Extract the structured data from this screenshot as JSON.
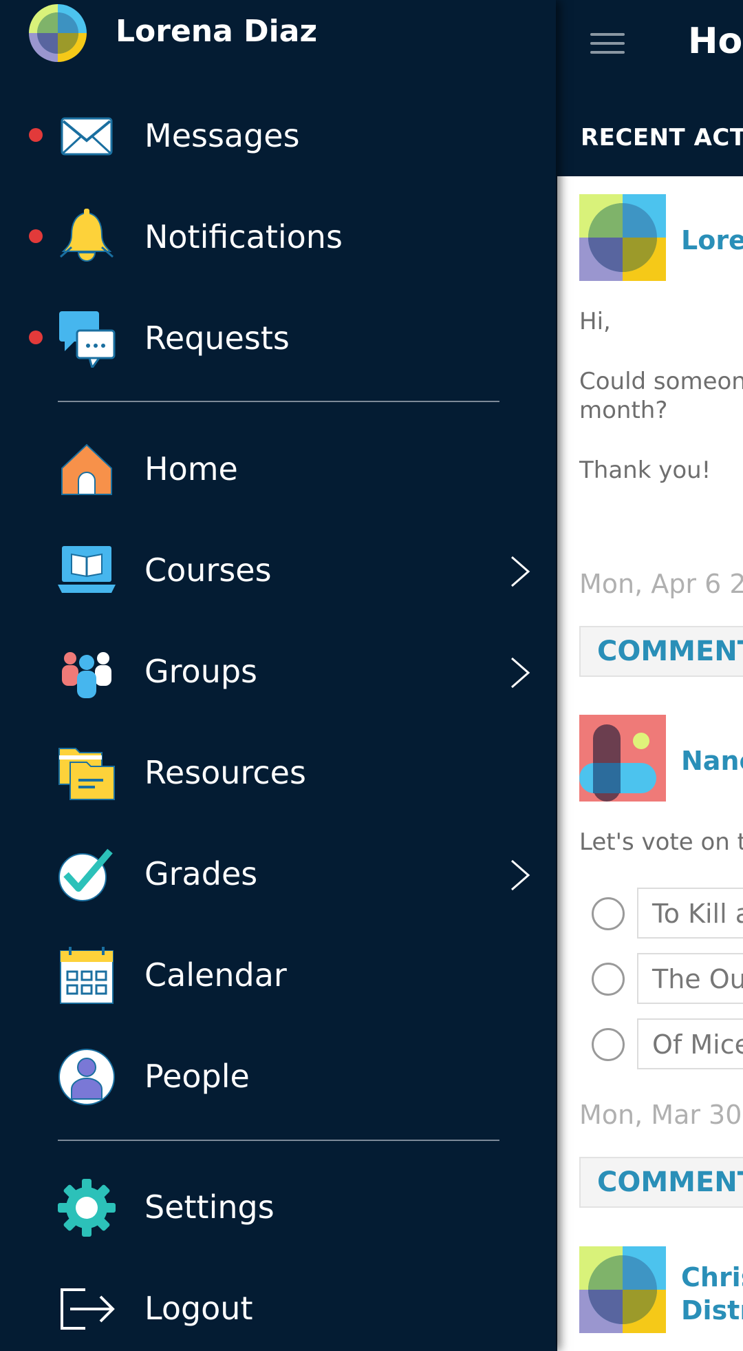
{
  "colors": {
    "navy": "#041c33",
    "accent_blue": "#2a8fb8",
    "alert_red": "#e23a3a"
  },
  "drawer": {
    "profile": {
      "name": "Lorena Diaz",
      "avatar_icon": "quad-avatar-icon"
    },
    "alerts": [
      {
        "label": "Messages",
        "icon": "envelope-icon",
        "has_alert": true
      },
      {
        "label": "Notifications",
        "icon": "bell-icon",
        "has_alert": true
      },
      {
        "label": "Requests",
        "icon": "chat-bubbles-icon",
        "has_alert": true
      }
    ],
    "nav": [
      {
        "label": "Home",
        "icon": "house-icon",
        "has_submenu": false
      },
      {
        "label": "Courses",
        "icon": "laptop-book-icon",
        "has_submenu": true
      },
      {
        "label": "Groups",
        "icon": "people-group-icon",
        "has_submenu": true
      },
      {
        "label": "Resources",
        "icon": "folders-icon",
        "has_submenu": false
      },
      {
        "label": "Grades",
        "icon": "checkmark-icon",
        "has_submenu": true
      },
      {
        "label": "Calendar",
        "icon": "calendar-icon",
        "has_submenu": false
      },
      {
        "label": "People",
        "icon": "person-icon",
        "has_submenu": false
      }
    ],
    "footer": [
      {
        "label": "Settings",
        "icon": "gear-icon"
      },
      {
        "label": "Logout",
        "icon": "logout-icon"
      }
    ]
  },
  "main": {
    "title": "Hor",
    "recent_activity": "RECENT ACTIV",
    "posts": [
      {
        "author": "Loren",
        "lines": [
          "Hi,",
          "Could someon",
          "month?",
          "Thank you!"
        ],
        "date": "Mon, Apr 6 2",
        "comment_label": "COMMENT"
      },
      {
        "author": "Nanc",
        "lines": [
          "Let's vote on th"
        ],
        "poll_options": [
          "To Kill a",
          "The Ou",
          "Of Mice"
        ],
        "date": "Mon, Mar 30",
        "comment_label": "COMMENT"
      },
      {
        "author_lines": [
          "Chris",
          "Distr"
        ]
      }
    ]
  }
}
